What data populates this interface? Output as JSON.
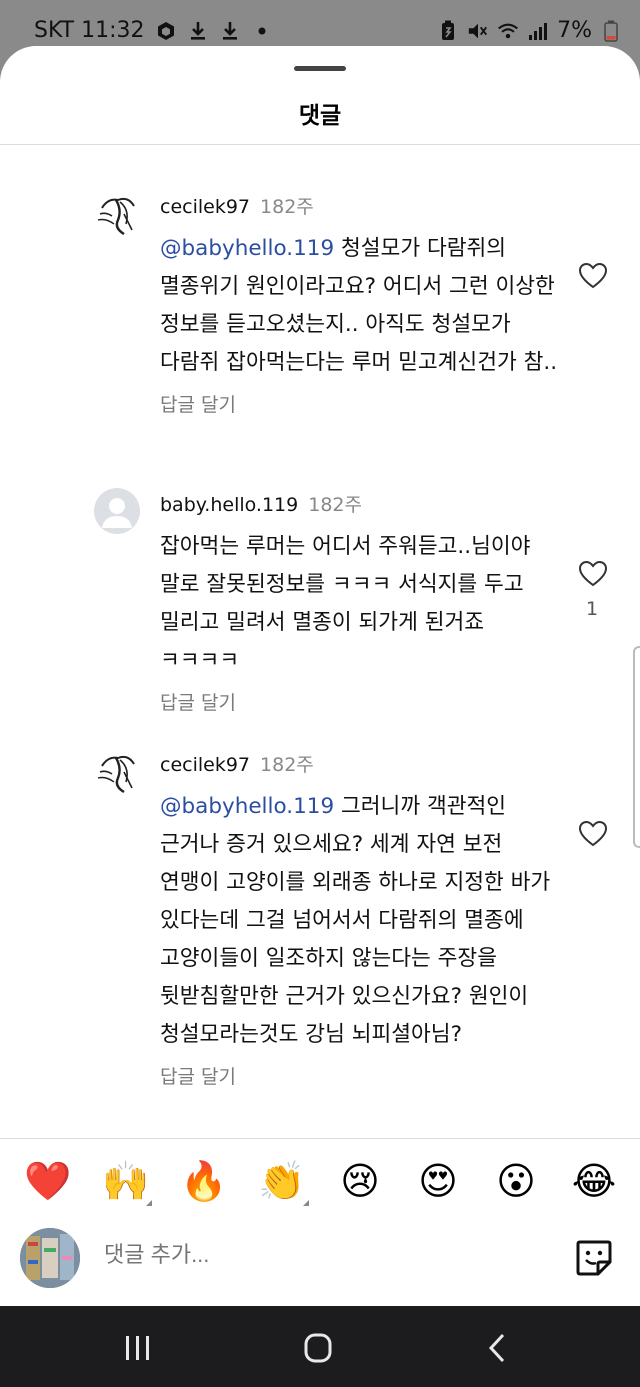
{
  "status": {
    "carrier_time": "SKT 11:32",
    "battery": "7%"
  },
  "sheet": {
    "title": "댓글"
  },
  "comments": [
    {
      "user": "cecilek97",
      "time": "182주",
      "mention": "@babyhello.119",
      "text": " 청설모가 다람쥐의 멸종위기 원인이라고요? 어디서 그런 이상한 정보를 듣고오셨는지.. 아직도 청설모가 다람쥐 잡아먹는다는 루머 믿고계신건가 참..",
      "reply_label": "답글 달기",
      "likes": ""
    },
    {
      "user": "baby.hello.119",
      "time": "182주",
      "mention": "",
      "text": "잡아먹는 루머는 어디서 주워듣고..님이야 말로 잘못된정보를 ㅋㅋㅋ 서식지를 두고 밀리고 밀려서 멸종이 되가게 된거죠 ㅋㅋㅋㅋ",
      "reply_label": "답글 달기",
      "likes": "1"
    },
    {
      "user": "cecilek97",
      "time": "182주",
      "mention": "@babyhello.119",
      "text": " 그러니까 객관적인 근거나 증거 있으세요? 세계 자연 보전 연맹이 고양이를 외래종 하나로 지정한 바가 있다는데 그걸 넘어서서 다람쥐의 멸종에 고양이들이 일조하지 않는다는 주장을 뒷받침할만한 근거가 있으신가요? 원인이 청설모라는것도 강님 뇌피셜아님?",
      "reply_label": "답글 달기",
      "likes": ""
    }
  ],
  "emoji_reactions": [
    "❤️",
    "🙌",
    "🔥",
    "👏",
    "😢",
    "😍",
    "😮",
    "😂"
  ],
  "composer": {
    "placeholder": "댓글 추가..."
  },
  "nav": {
    "recents_icon": "recents-icon",
    "home_icon": "home-icon",
    "back_icon": "back-icon"
  }
}
